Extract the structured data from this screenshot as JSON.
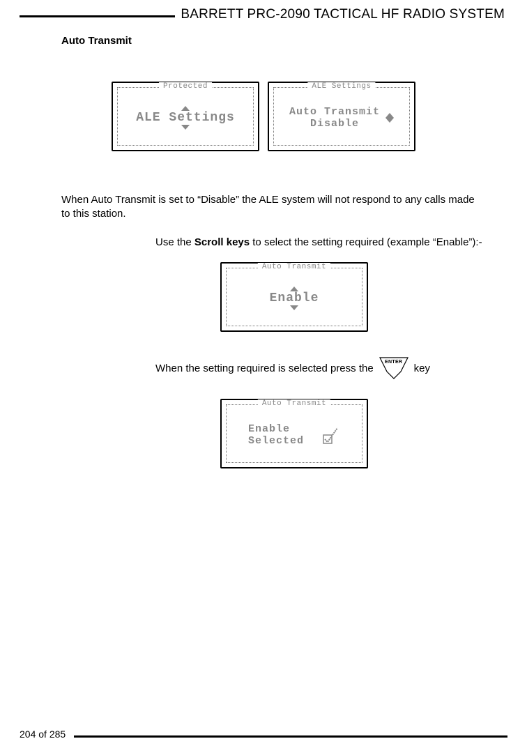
{
  "header": {
    "title": "BARRETT PRC-2090 TACTICAL HF RADIO SYSTEM"
  },
  "section": {
    "title": "Auto Transmit"
  },
  "screens": {
    "s1": {
      "head": "Protected",
      "line1": "ALE Settings"
    },
    "s2": {
      "head": "ALE Settings",
      "line1": "Auto Transmit",
      "line2": "Disable"
    },
    "s3": {
      "head": "Auto Transmit",
      "line1": "Enable"
    },
    "s4": {
      "head": "Auto Transmit",
      "line1": "Enable",
      "line2": "Selected"
    }
  },
  "para1": "When Auto Transmit is set to “Disable” the ALE system will not respond to any calls made to this station.",
  "para2a": "Use the ",
  "para2b": "Scroll keys",
  "para2c": " to select the setting required (example “Enable”):-",
  "press": {
    "before": "When the setting required is selected press the",
    "after": "key",
    "keyLabel": "ENTER"
  },
  "footer": {
    "page": "204 of 285"
  }
}
